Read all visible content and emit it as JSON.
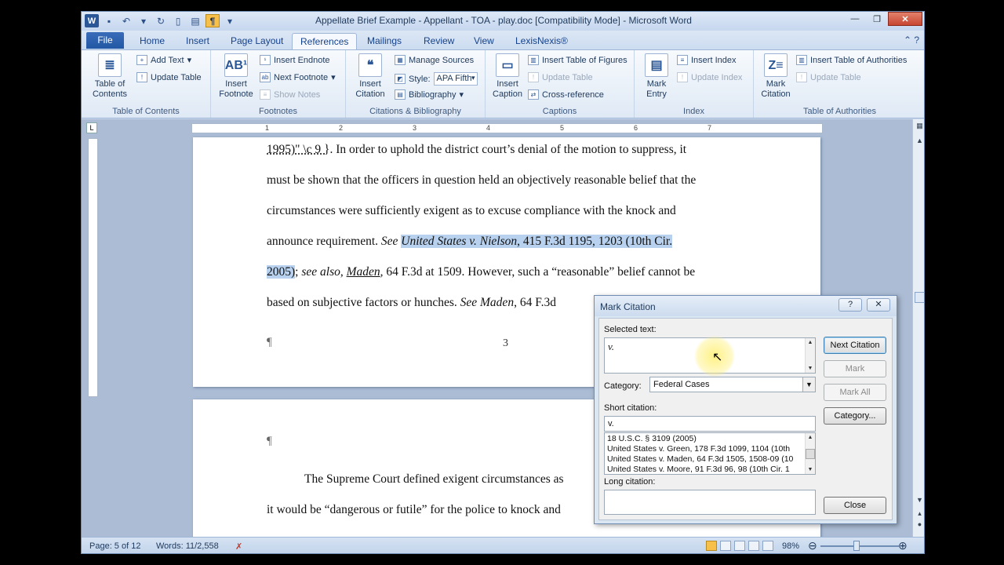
{
  "window": {
    "title": "Appellate Brief Example - Appellant - TOA - play.doc [Compatibility Mode] - Microsoft Word"
  },
  "qat": {
    "word_logo": "W",
    "pilcrow": "¶"
  },
  "tabs": [
    {
      "label": "File"
    },
    {
      "label": "Home"
    },
    {
      "label": "Insert"
    },
    {
      "label": "Page Layout"
    },
    {
      "label": "References"
    },
    {
      "label": "Mailings"
    },
    {
      "label": "Review"
    },
    {
      "label": "View"
    },
    {
      "label": "LexisNexis®"
    }
  ],
  "ribbon": {
    "toc": {
      "group_label": "Table of Contents",
      "toc_btn": "Table of Contents",
      "add_text": "Add Text",
      "update_table": "Update Table"
    },
    "footnotes": {
      "group_label": "Footnotes",
      "insert_footnote": "Insert Footnote",
      "insert_endnote": "Insert Endnote",
      "next_footnote": "Next Footnote",
      "show_notes": "Show Notes"
    },
    "citations": {
      "group_label": "Citations & Bibliography",
      "insert_citation": "Insert Citation",
      "manage_sources": "Manage Sources",
      "style_label": "Style:",
      "style_value": "APA Fifth",
      "bibliography": "Bibliography"
    },
    "captions": {
      "group_label": "Captions",
      "insert_caption": "Insert Caption",
      "insert_tof": "Insert Table of Figures",
      "update_table": "Update Table",
      "cross_reference": "Cross-reference"
    },
    "index": {
      "group_label": "Index",
      "mark_entry": "Mark Entry",
      "insert_index": "Insert Index",
      "update_index": "Update Index"
    },
    "toa": {
      "group_label": "Table of Authorities",
      "mark_citation": "Mark Citation",
      "insert_toa": "Insert Table of Authorities",
      "update_table": "Update Table"
    }
  },
  "ruler": [
    "1",
    "2",
    "3",
    "4",
    "5",
    "6",
    "7"
  ],
  "document": {
    "page1": {
      "l1_field": "1995)\" \\c 9 }",
      "l1_rest": ". In order to uphold the district court’s denial of the motion to suppress, it",
      "l2": "must be shown that the officers in question held an objectively reasonable belief that the",
      "l3": "circumstances were sufficiently exigent as to excuse compliance with the knock and",
      "l4_a": "announce requirement. ",
      "l4_see": "See",
      "l4_cite": "United States v. Nielson",
      "l4_rest": ", 415 F.3d 1195, 1203 (10th Cir.",
      "l5_year": "2005)",
      "l5_semi": "; ",
      "l5_seealso": "see also",
      "l5_comma": ", ",
      "l5_maden": "Maden",
      "l5_rest": ", 64 F.3d at 1509. However, such a “reasonable” belief cannot be",
      "l6_a": "based on subjective factors or hunches. ",
      "l6_see": "See Maden",
      "l6_rest": ", 64 F.3d",
      "pilcrow": "¶",
      "page_number": "3"
    },
    "page2": {
      "pilcrow": "¶",
      "l1": "The Supreme Court defined exigent circumstances as",
      "l2": "it would be “dangerous or futile” for the police to knock and"
    }
  },
  "status": {
    "page": "Page: 5 of 12",
    "words": "Words: 11/2,558",
    "zoom": "98%"
  },
  "dialog": {
    "title": "Mark Citation",
    "selected_text_label": "Selected text:",
    "selected_text": "v.",
    "category_label": "Category:",
    "category_value": "Federal Cases",
    "short_citation_label": "Short citation:",
    "short_citation": "v.",
    "short_list": [
      "18 U.S.C. § 3109 (2005)",
      "United States v. Green, 178 F.3d 1099, 1104 (10th",
      "United States v. Maden, 64 F.3d 1505, 1508-09 (10",
      "United States v. Moore, 91 F.3d 96, 98 (10th Cir. 1"
    ],
    "long_citation_label": "Long citation:",
    "buttons": {
      "next": "Next Citation",
      "mark": "Mark",
      "mark_all": "Mark All",
      "category": "Category...",
      "close": "Close"
    }
  }
}
